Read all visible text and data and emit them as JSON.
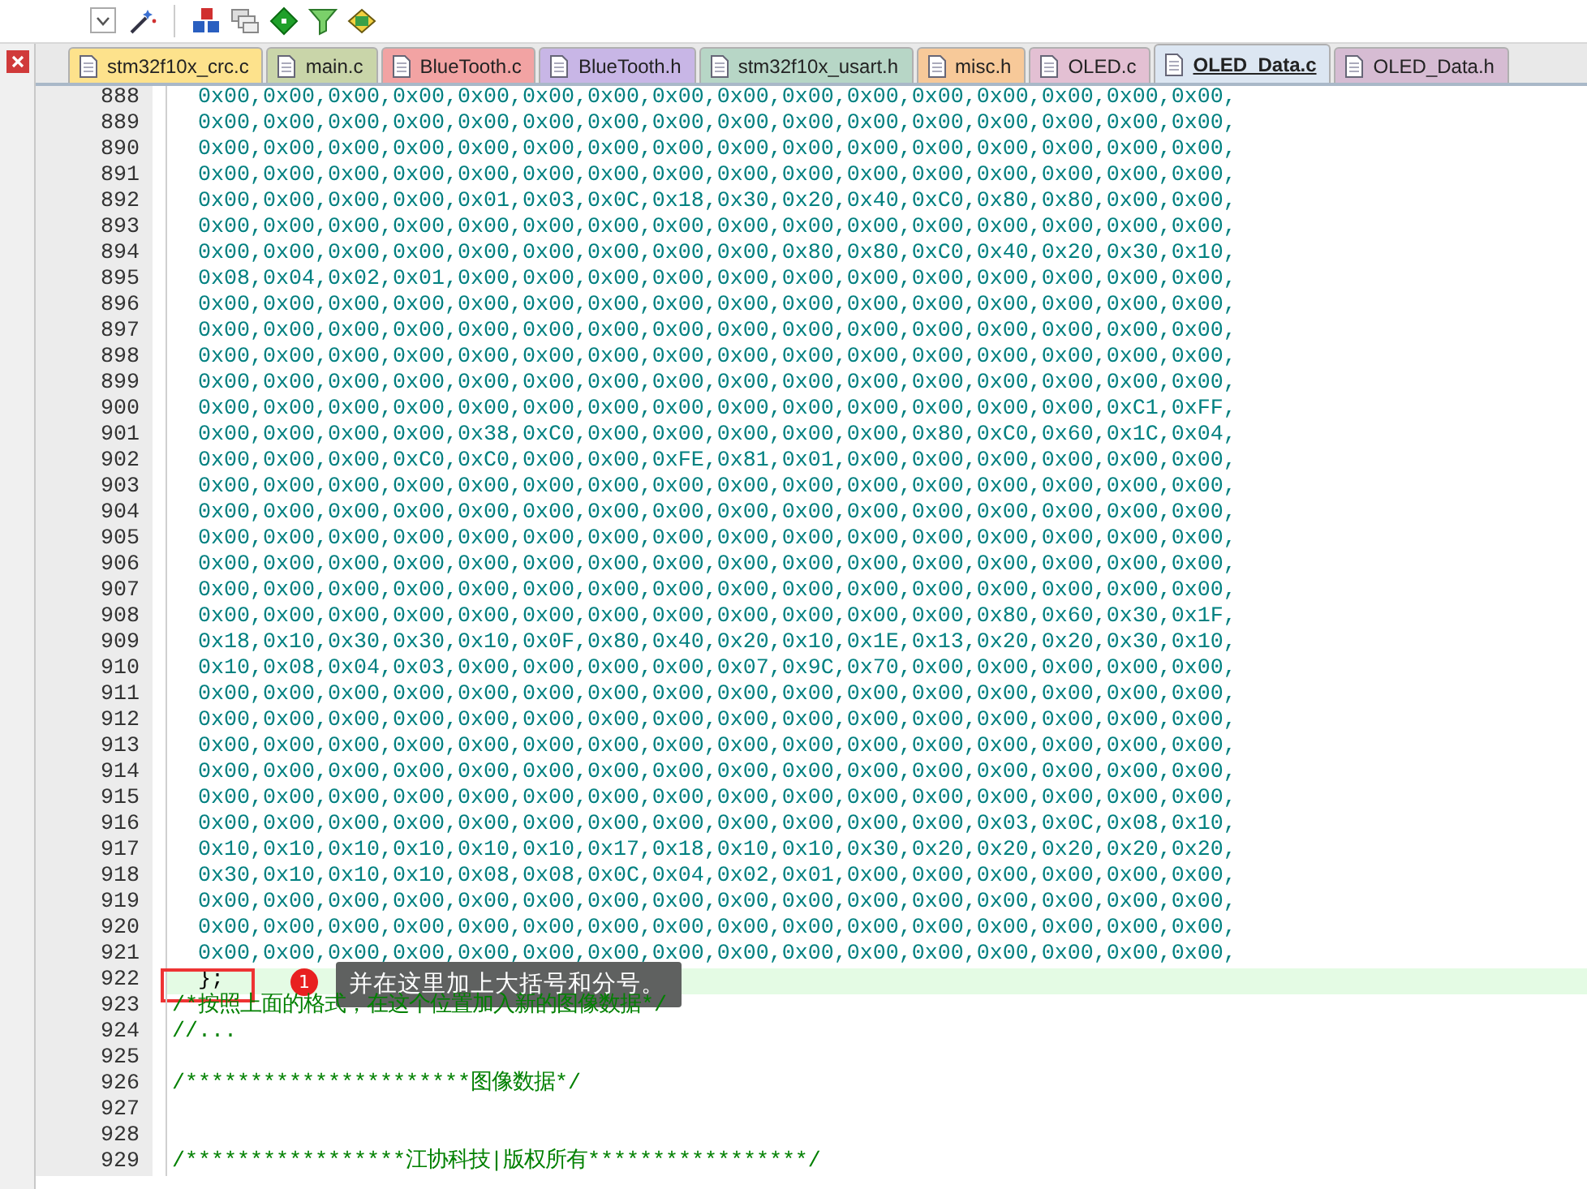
{
  "tabs": [
    {
      "label": "stm32f10x_crc.c",
      "selected": false,
      "color": "#fde28c"
    },
    {
      "label": "main.c",
      "selected": false,
      "color": "#c9d5a9"
    },
    {
      "label": "BlueTooth.c",
      "selected": false,
      "color": "#f2a3a3"
    },
    {
      "label": "BlueTooth.h",
      "selected": false,
      "color": "#c8b6e6"
    },
    {
      "label": "stm32f10x_usart.h",
      "selected": false,
      "color": "#b7d6c6"
    },
    {
      "label": "misc.h",
      "selected": false,
      "color": "#f7c999"
    },
    {
      "label": "OLED.c",
      "selected": false,
      "color": "#e3c0d3"
    },
    {
      "label": "OLED_Data.c",
      "selected": true,
      "color": "#dce6f2"
    },
    {
      "label": "OLED_Data.h",
      "selected": false,
      "color": "#d6bcd3"
    }
  ],
  "lines": [
    {
      "number": "888",
      "kind": "data",
      "text": "0x00,0x00,0x00,0x00,0x00,0x00,0x00,0x00,0x00,0x00,0x00,0x00,0x00,0x00,0x00,0x00,"
    },
    {
      "number": "889",
      "kind": "data",
      "text": "0x00,0x00,0x00,0x00,0x00,0x00,0x00,0x00,0x00,0x00,0x00,0x00,0x00,0x00,0x00,0x00,"
    },
    {
      "number": "890",
      "kind": "data",
      "text": "0x00,0x00,0x00,0x00,0x00,0x00,0x00,0x00,0x00,0x00,0x00,0x00,0x00,0x00,0x00,0x00,"
    },
    {
      "number": "891",
      "kind": "data",
      "text": "0x00,0x00,0x00,0x00,0x00,0x00,0x00,0x00,0x00,0x00,0x00,0x00,0x00,0x00,0x00,0x00,"
    },
    {
      "number": "892",
      "kind": "data",
      "text": "0x00,0x00,0x00,0x00,0x01,0x03,0x0C,0x18,0x30,0x20,0x40,0xC0,0x80,0x80,0x00,0x00,"
    },
    {
      "number": "893",
      "kind": "data",
      "text": "0x00,0x00,0x00,0x00,0x00,0x00,0x00,0x00,0x00,0x00,0x00,0x00,0x00,0x00,0x00,0x00,"
    },
    {
      "number": "894",
      "kind": "data",
      "text": "0x00,0x00,0x00,0x00,0x00,0x00,0x00,0x00,0x00,0x80,0x80,0xC0,0x40,0x20,0x30,0x10,"
    },
    {
      "number": "895",
      "kind": "data",
      "text": "0x08,0x04,0x02,0x01,0x00,0x00,0x00,0x00,0x00,0x00,0x00,0x00,0x00,0x00,0x00,0x00,"
    },
    {
      "number": "896",
      "kind": "data",
      "text": "0x00,0x00,0x00,0x00,0x00,0x00,0x00,0x00,0x00,0x00,0x00,0x00,0x00,0x00,0x00,0x00,"
    },
    {
      "number": "897",
      "kind": "data",
      "text": "0x00,0x00,0x00,0x00,0x00,0x00,0x00,0x00,0x00,0x00,0x00,0x00,0x00,0x00,0x00,0x00,"
    },
    {
      "number": "898",
      "kind": "data",
      "text": "0x00,0x00,0x00,0x00,0x00,0x00,0x00,0x00,0x00,0x00,0x00,0x00,0x00,0x00,0x00,0x00,"
    },
    {
      "number": "899",
      "kind": "data",
      "text": "0x00,0x00,0x00,0x00,0x00,0x00,0x00,0x00,0x00,0x00,0x00,0x00,0x00,0x00,0x00,0x00,"
    },
    {
      "number": "900",
      "kind": "data",
      "text": "0x00,0x00,0x00,0x00,0x00,0x00,0x00,0x00,0x00,0x00,0x00,0x00,0x00,0x00,0xC1,0xFF,"
    },
    {
      "number": "901",
      "kind": "data",
      "text": "0x00,0x00,0x00,0x00,0x38,0xC0,0x00,0x00,0x00,0x00,0x00,0x80,0xC0,0x60,0x1C,0x04,"
    },
    {
      "number": "902",
      "kind": "data",
      "text": "0x00,0x00,0x00,0xC0,0xC0,0x00,0x00,0xFE,0x81,0x01,0x00,0x00,0x00,0x00,0x00,0x00,"
    },
    {
      "number": "903",
      "kind": "data",
      "text": "0x00,0x00,0x00,0x00,0x00,0x00,0x00,0x00,0x00,0x00,0x00,0x00,0x00,0x00,0x00,0x00,"
    },
    {
      "number": "904",
      "kind": "data",
      "text": "0x00,0x00,0x00,0x00,0x00,0x00,0x00,0x00,0x00,0x00,0x00,0x00,0x00,0x00,0x00,0x00,"
    },
    {
      "number": "905",
      "kind": "data",
      "text": "0x00,0x00,0x00,0x00,0x00,0x00,0x00,0x00,0x00,0x00,0x00,0x00,0x00,0x00,0x00,0x00,"
    },
    {
      "number": "906",
      "kind": "data",
      "text": "0x00,0x00,0x00,0x00,0x00,0x00,0x00,0x00,0x00,0x00,0x00,0x00,0x00,0x00,0x00,0x00,"
    },
    {
      "number": "907",
      "kind": "data",
      "text": "0x00,0x00,0x00,0x00,0x00,0x00,0x00,0x00,0x00,0x00,0x00,0x00,0x00,0x00,0x00,0x00,"
    },
    {
      "number": "908",
      "kind": "data",
      "text": "0x00,0x00,0x00,0x00,0x00,0x00,0x00,0x00,0x00,0x00,0x00,0x00,0x80,0x60,0x30,0x1F,"
    },
    {
      "number": "909",
      "kind": "data",
      "text": "0x18,0x10,0x30,0x30,0x10,0x0F,0x80,0x40,0x20,0x10,0x1E,0x13,0x20,0x20,0x30,0x10,"
    },
    {
      "number": "910",
      "kind": "data",
      "text": "0x10,0x08,0x04,0x03,0x00,0x00,0x00,0x00,0x07,0x9C,0x70,0x00,0x00,0x00,0x00,0x00,"
    },
    {
      "number": "911",
      "kind": "data",
      "text": "0x00,0x00,0x00,0x00,0x00,0x00,0x00,0x00,0x00,0x00,0x00,0x00,0x00,0x00,0x00,0x00,"
    },
    {
      "number": "912",
      "kind": "data",
      "text": "0x00,0x00,0x00,0x00,0x00,0x00,0x00,0x00,0x00,0x00,0x00,0x00,0x00,0x00,0x00,0x00,"
    },
    {
      "number": "913",
      "kind": "data",
      "text": "0x00,0x00,0x00,0x00,0x00,0x00,0x00,0x00,0x00,0x00,0x00,0x00,0x00,0x00,0x00,0x00,"
    },
    {
      "number": "914",
      "kind": "data",
      "text": "0x00,0x00,0x00,0x00,0x00,0x00,0x00,0x00,0x00,0x00,0x00,0x00,0x00,0x00,0x00,0x00,"
    },
    {
      "number": "915",
      "kind": "data",
      "text": "0x00,0x00,0x00,0x00,0x00,0x00,0x00,0x00,0x00,0x00,0x00,0x00,0x00,0x00,0x00,0x00,"
    },
    {
      "number": "916",
      "kind": "data",
      "text": "0x00,0x00,0x00,0x00,0x00,0x00,0x00,0x00,0x00,0x00,0x00,0x00,0x03,0x0C,0x08,0x10,"
    },
    {
      "number": "917",
      "kind": "data",
      "text": "0x10,0x10,0x10,0x10,0x10,0x10,0x17,0x18,0x10,0x10,0x30,0x20,0x20,0x20,0x20,0x20,"
    },
    {
      "number": "918",
      "kind": "data",
      "text": "0x30,0x10,0x10,0x10,0x08,0x08,0x0C,0x04,0x02,0x01,0x00,0x00,0x00,0x00,0x00,0x00,"
    },
    {
      "number": "919",
      "kind": "data",
      "text": "0x00,0x00,0x00,0x00,0x00,0x00,0x00,0x00,0x00,0x00,0x00,0x00,0x00,0x00,0x00,0x00,"
    },
    {
      "number": "920",
      "kind": "data",
      "text": "0x00,0x00,0x00,0x00,0x00,0x00,0x00,0x00,0x00,0x00,0x00,0x00,0x00,0x00,0x00,0x00,"
    },
    {
      "number": "921",
      "kind": "data",
      "text": "0x00,0x00,0x00,0x00,0x00,0x00,0x00,0x00,0x00,0x00,0x00,0x00,0x00,0x00,0x00,0x00,"
    },
    {
      "number": "922",
      "kind": "code",
      "text": "};",
      "current": true,
      "boxed": true,
      "callout": {
        "number": "1",
        "text": "并在这里加上大括号和分号。"
      }
    },
    {
      "number": "923",
      "kind": "comment",
      "text": "/*按照上面的格式，在这个位置加入新的图像数据*/"
    },
    {
      "number": "924",
      "kind": "comment",
      "text": "//..."
    },
    {
      "number": "925",
      "kind": "blank"
    },
    {
      "number": "926",
      "kind": "comment",
      "text": "/**********************图像数据*/"
    },
    {
      "number": "927",
      "kind": "blank"
    },
    {
      "number": "928",
      "kind": "blank"
    },
    {
      "number": "929",
      "kind": "comment",
      "text": "/*****************江协科技|版权所有*****************/"
    }
  ]
}
